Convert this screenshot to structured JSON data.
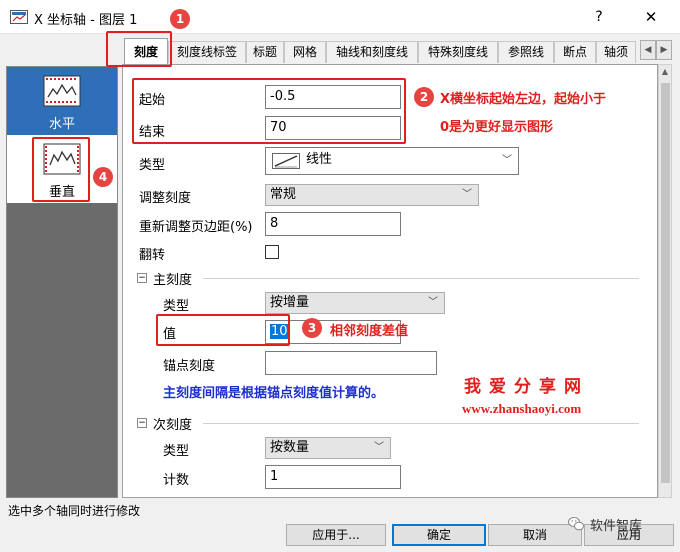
{
  "window": {
    "title": "X 坐标轴 - 图层 1",
    "help_label": "?",
    "close_label": "✕"
  },
  "tabs": [
    {
      "label": "刻度",
      "active": true
    },
    {
      "label": "刻度线标签"
    },
    {
      "label": "标题"
    },
    {
      "label": "网格"
    },
    {
      "label": "轴线和刻度线"
    },
    {
      "label": "特殊刻度线"
    },
    {
      "label": "参照线"
    },
    {
      "label": "断点"
    },
    {
      "label": "轴须"
    }
  ],
  "tab_arrows": {
    "left": "◀",
    "right": "▶"
  },
  "axes_list": [
    {
      "label": "水平",
      "selected": true,
      "icon": "horizontal-axis-icon"
    },
    {
      "label": "垂直",
      "selected": false,
      "icon": "vertical-axis-icon"
    }
  ],
  "scale": {
    "from_label": "起始",
    "from_value": "-0.5",
    "to_label": "结束",
    "to_value": "70",
    "type_label": "类型",
    "type_value": "线性",
    "rescale_label": "调整刻度",
    "rescale_value": "常规",
    "rescale_margin_label": "重新调整页边距(%)",
    "rescale_margin_value": "8",
    "reverse_label": "翻转",
    "reverse_checked": false
  },
  "major_ticks": {
    "section_label": "主刻度",
    "toggle": "−",
    "type_label": "类型",
    "type_value": "按增量",
    "value_label": "值",
    "value": "10",
    "anchor_label": "锚点刻度",
    "anchor_value": "",
    "info_text": "主刻度间隔是根据锚点刻度值计算的。"
  },
  "minor_ticks": {
    "section_label": "次刻度",
    "toggle": "−",
    "type_label": "类型",
    "type_value": "按数量",
    "count_label": "计数",
    "count_value": "1"
  },
  "annotations": {
    "badge1": "1",
    "badge2": "2",
    "badge3": "3",
    "badge4": "4",
    "note2_line1": "X横坐标起始左边，起始小于",
    "note2_line2": "0是为更好显示图形",
    "note3": "相邻刻度差值"
  },
  "watermark": {
    "cn": "我爱分享网",
    "url": "www.zhanshaoyi.com",
    "wechat": "软件智库"
  },
  "status_text": "选中多个轴同时进行修改",
  "buttons": {
    "apply_to": "应用于...",
    "ok": "确定",
    "cancel": "取消",
    "apply": "应用"
  },
  "colors": {
    "annotation_red": "#e0201f",
    "selection_blue": "#2f6fb8",
    "info_blue": "#1e2fd0"
  }
}
